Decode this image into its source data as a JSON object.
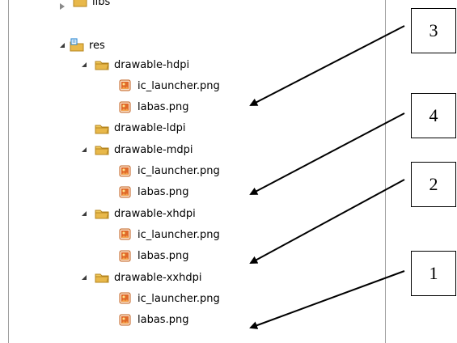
{
  "tree": {
    "top_partial_label": "libs",
    "res_label": "res",
    "folders": [
      {
        "name": "drawable-hdpi",
        "expanded": true,
        "files": [
          "ic_launcher.png",
          "labas.png"
        ]
      },
      {
        "name": "drawable-ldpi",
        "expanded": false,
        "files": []
      },
      {
        "name": "drawable-mdpi",
        "expanded": true,
        "files": [
          "ic_launcher.png",
          "labas.png"
        ]
      },
      {
        "name": "drawable-xhdpi",
        "expanded": true,
        "files": [
          "ic_launcher.png",
          "labas.png"
        ]
      },
      {
        "name": "drawable-xxhdpi",
        "expanded": true,
        "files": [
          "ic_launcher.png",
          "labas.png"
        ]
      }
    ]
  },
  "callouts": [
    "3",
    "4",
    "2",
    "1"
  ],
  "colors": {
    "folder": "#e8b84a",
    "png_icon": "#e06a2a",
    "res_icon": "#3a8fd6"
  }
}
